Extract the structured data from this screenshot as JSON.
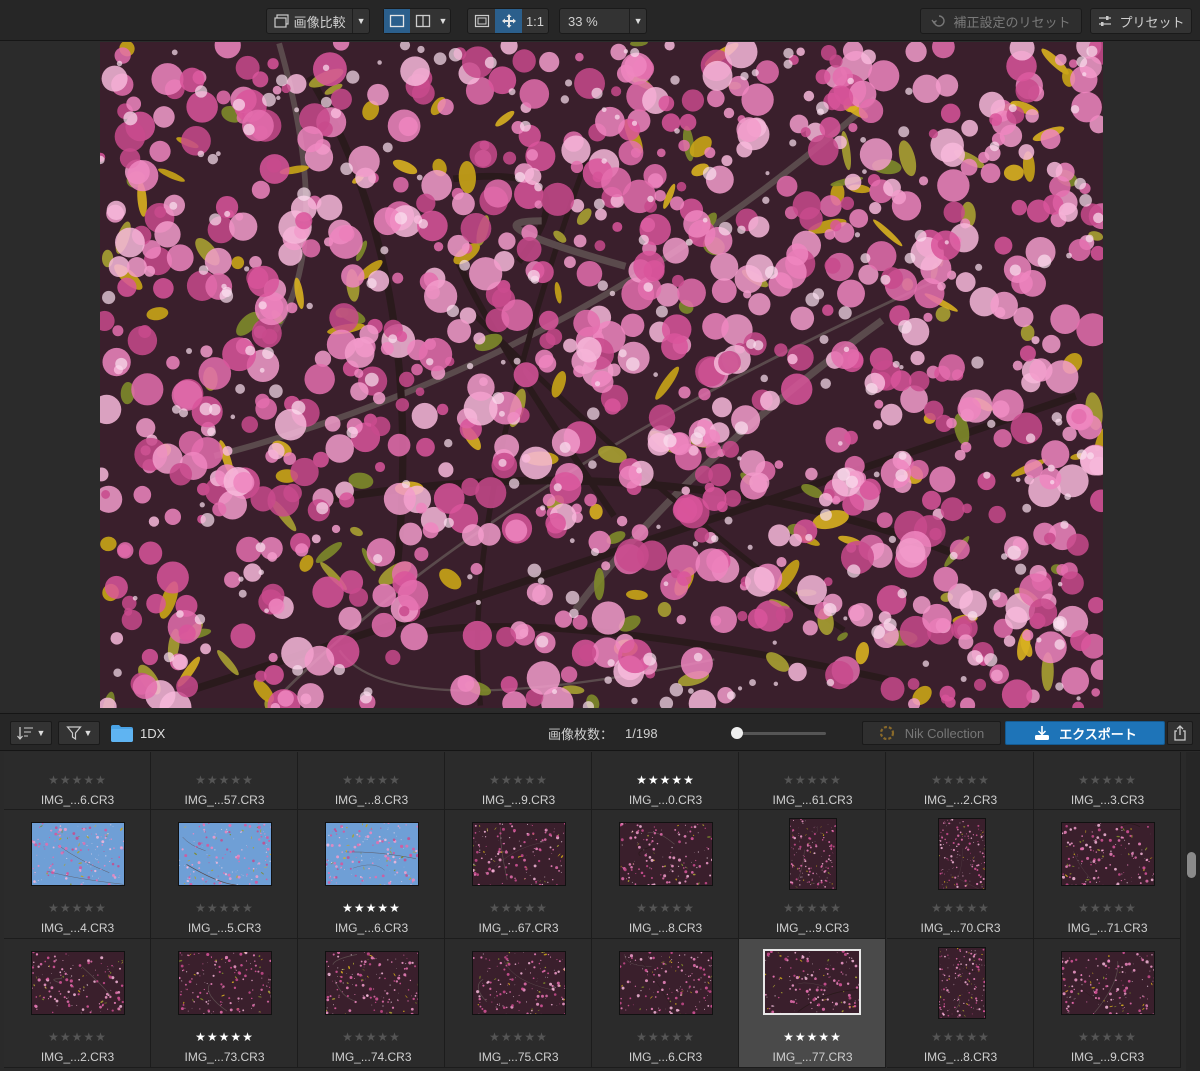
{
  "toolbar": {
    "compare_label": "画像比較",
    "one_to_one": "1:1",
    "zoom": "33 %",
    "reset_label": "補正設定のリセット",
    "preset_label": "プリセット"
  },
  "filmstrip": {
    "folder_name": "1DX",
    "count_label": "画像枚数：",
    "count_value": "1/198",
    "nik_label": "Nik Collection",
    "export_label": "エクスポート"
  },
  "rows": [
    [
      {
        "name": "IMG_...6.CR3",
        "stars": "★★★★★",
        "rated": false
      },
      {
        "name": "IMG_...57.CR3",
        "stars": "★★★★★",
        "rated": false
      },
      {
        "name": "IMG_...8.CR3",
        "stars": "★★★★★",
        "rated": false
      },
      {
        "name": "IMG_...9.CR3",
        "stars": "★★★★★",
        "rated": false
      },
      {
        "name": "IMG_...0.CR3",
        "stars": "★★★★★",
        "rated": true
      },
      {
        "name": "IMG_...61.CR3",
        "stars": "★★★★★",
        "rated": false
      },
      {
        "name": "IMG_...2.CR3",
        "stars": "★★★★★",
        "rated": false
      },
      {
        "name": "IMG_...3.CR3",
        "stars": "★★★★★",
        "rated": false
      }
    ],
    [
      {
        "name": "IMG_...4.CR3",
        "stars": "★★★★★",
        "rated": false
      },
      {
        "name": "IMG_...5.CR3",
        "stars": "★★★★★",
        "rated": false
      },
      {
        "name": "IMG_...6.CR3",
        "stars": "★★★★★",
        "rated": true
      },
      {
        "name": "IMG_...67.CR3",
        "stars": "★★★★★",
        "rated": false
      },
      {
        "name": "IMG_...8.CR3",
        "stars": "★★★★★",
        "rated": false
      },
      {
        "name": "IMG_...9.CR3",
        "stars": "★★★★★",
        "rated": false
      },
      {
        "name": "IMG_...70.CR3",
        "stars": "★★★★★",
        "rated": false
      },
      {
        "name": "IMG_...71.CR3",
        "stars": "★★★★★",
        "rated": false
      }
    ],
    [
      {
        "name": "IMG_...2.CR3",
        "stars": "★★★★★",
        "rated": false
      },
      {
        "name": "IMG_...73.CR3",
        "stars": "★★★★★",
        "rated": true
      },
      {
        "name": "IMG_...74.CR3",
        "stars": "★★★★★",
        "rated": false
      },
      {
        "name": "IMG_...75.CR3",
        "stars": "★★★★★",
        "rated": false
      },
      {
        "name": "IMG_...6.CR3",
        "stars": "★★★★★",
        "rated": false
      },
      {
        "name": "IMG_...77.CR3",
        "stars": "★★★★★",
        "rated": true,
        "selected": true
      },
      {
        "name": "IMG_...8.CR3",
        "stars": "★★★★★",
        "rated": false
      },
      {
        "name": "IMG_...9.CR3",
        "stars": "★★★★★",
        "rated": false
      }
    ]
  ],
  "colors": {
    "accent": "#1e74b8",
    "active_button": "#2b5f8c",
    "blossom": "#e46fae",
    "panel": "#262626"
  }
}
